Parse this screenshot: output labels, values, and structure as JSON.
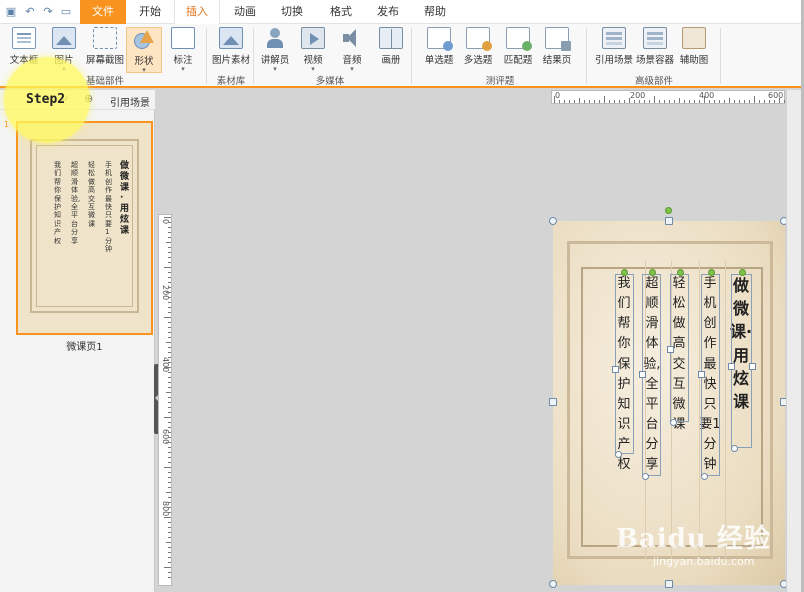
{
  "tabs": {
    "file": "文件",
    "home": "开始",
    "insert": "插入",
    "animation": "动画",
    "switch": "切换",
    "format": "格式",
    "publish": "发布",
    "help": "帮助"
  },
  "ribbon": {
    "textbox": "文本框",
    "picture": "图片",
    "screenshot": "屏幕截图",
    "shape": "形状",
    "annotation": "标注",
    "picture_material": "图片素材",
    "narrator": "讲解员",
    "video": "视频",
    "audio": "音频",
    "album": "画册",
    "single_choice": "单选题",
    "multi_choice": "多选题",
    "matching": "匹配题",
    "result_page": "结果页",
    "ref_scene": "引用场景",
    "scene_container": "场景容器",
    "aux_image": "辅助图",
    "groups": {
      "basic": "基础部件",
      "material": "素材库",
      "multimedia": "多媒体",
      "quiz": "测评题",
      "advanced": "高级部件"
    }
  },
  "left_panel": {
    "ref_scene": "引用场景",
    "slide_number": "1",
    "slide_label": "微课页1"
  },
  "step_label": "Step2",
  "ruler": {
    "h": [
      "0",
      "200",
      "400",
      "600"
    ],
    "v": [
      "0",
      "200",
      "400",
      "600",
      "800"
    ]
  },
  "slide_text": {
    "title": "做微课·用炫课",
    "line1": "手机创作最快只要1分钟",
    "line2": "轻松做高交互微课",
    "line3": "超顺滑体验,全平台分享",
    "line4": "我们帮你保护知识产权"
  },
  "watermark": {
    "main": "Baidu 经验",
    "url": "jingyan.baidu.com"
  },
  "icons": {
    "save": "save-icon",
    "undo": "undo-icon",
    "redo": "redo-icon",
    "preview": "preview-icon"
  }
}
